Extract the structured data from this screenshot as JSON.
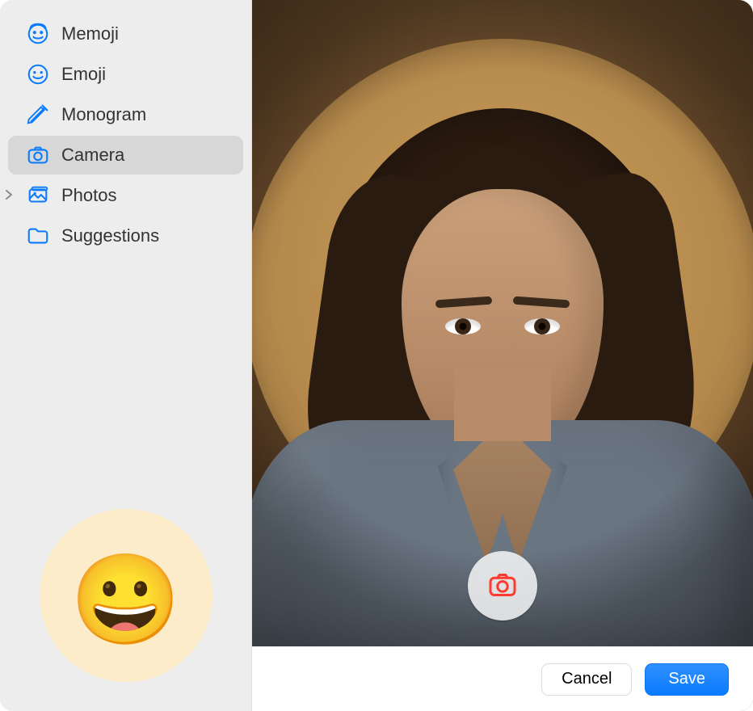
{
  "sidebar": {
    "items": [
      {
        "label": "Memoji",
        "icon": "memoji-face-icon"
      },
      {
        "label": "Emoji",
        "icon": "emoji-smile-icon"
      },
      {
        "label": "Monogram",
        "icon": "pencil-icon"
      },
      {
        "label": "Camera",
        "icon": "camera-icon",
        "selected": true
      },
      {
        "label": "Photos",
        "icon": "photos-icon",
        "expandable": true
      },
      {
        "label": "Suggestions",
        "icon": "folder-icon"
      }
    ],
    "current_avatar_emoji": "😀"
  },
  "capture_button": {
    "aria": "Take Photo"
  },
  "footer": {
    "cancel_label": "Cancel",
    "save_label": "Save"
  },
  "colors": {
    "accent": "#0a7bff",
    "sidebar_bg": "#ecedec",
    "sidebar_selected": "#d6d7d6"
  }
}
